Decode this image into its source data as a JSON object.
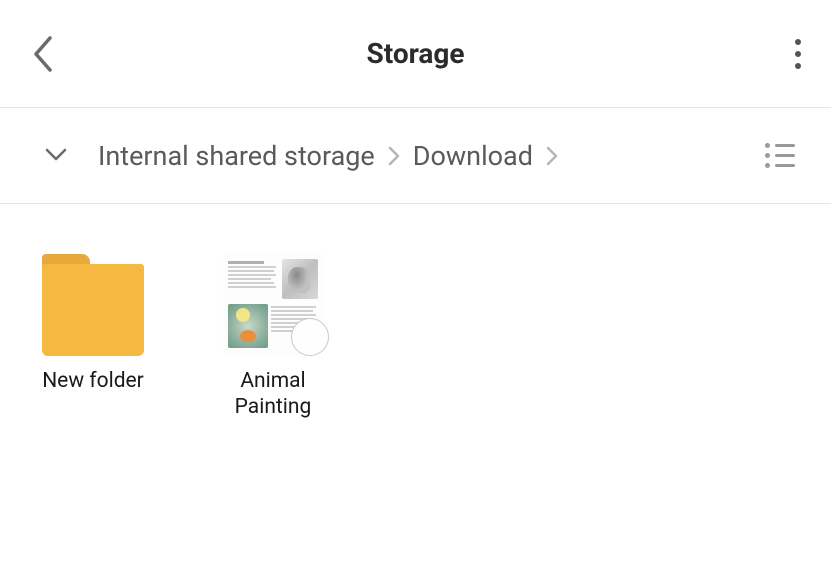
{
  "header": {
    "title": "Storage"
  },
  "breadcrumb": {
    "items": [
      "Internal shared storage",
      "Download"
    ]
  },
  "files": [
    {
      "type": "folder",
      "label": "New folder"
    },
    {
      "type": "file",
      "label": "Animal Painting"
    }
  ]
}
